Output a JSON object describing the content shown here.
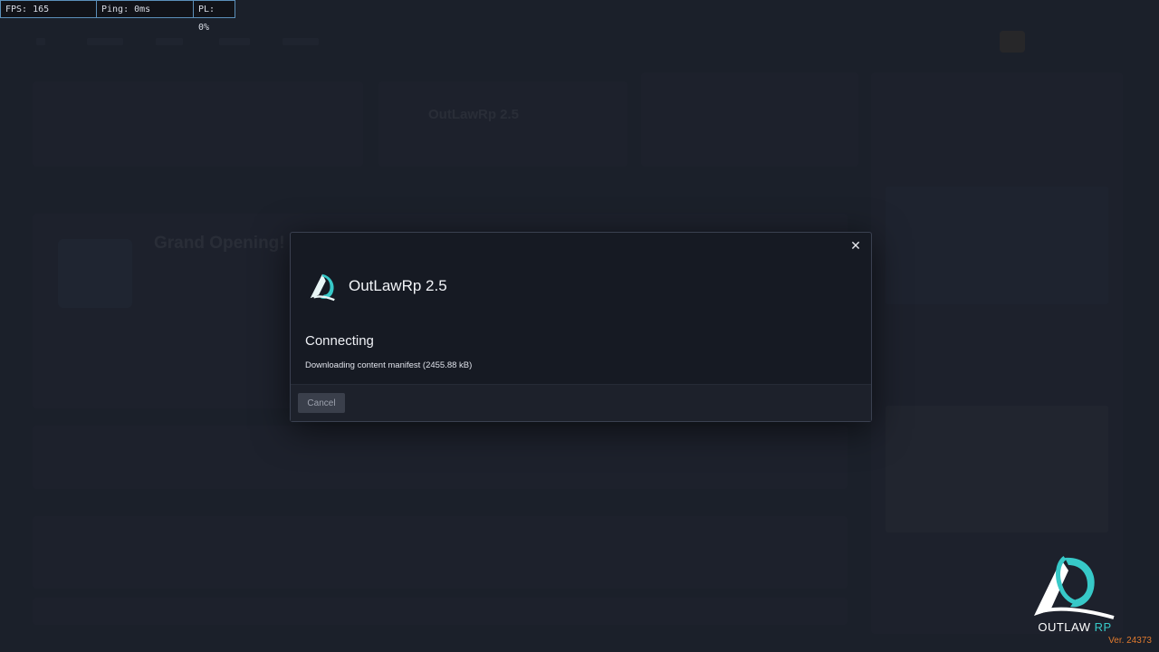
{
  "hud": {
    "fps": "FPS: 165",
    "ping": "Ping: 0ms",
    "pl": "PL: 0%"
  },
  "background": {
    "server_card_title": "OutLawRp 2.5",
    "featured_title": "Grand Opening!"
  },
  "modal": {
    "close_icon": "close-icon",
    "server_icon": "outlaw-rp-logo-icon",
    "server_name": "OutLawRp 2.5",
    "status_title": "Connecting",
    "status_detail": "Downloading content manifest (2455.88 kB)",
    "cancel_label": "Cancel"
  },
  "brand": {
    "name_main": "OUTLAW",
    "name_accent": "RP",
    "version": "Ver. 24373"
  },
  "colors": {
    "accent": "#37c9c8",
    "version_text": "#e07a2e",
    "hud_border": "#5b8fb9",
    "modal_bg": "#161a23"
  }
}
